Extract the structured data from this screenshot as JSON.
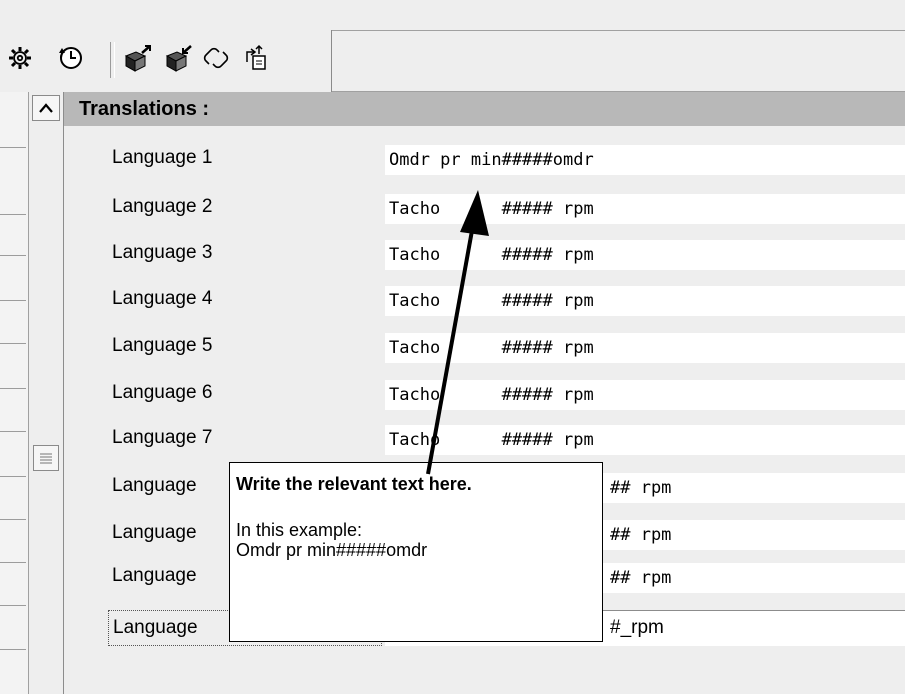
{
  "toolbar": {
    "icons": [
      "gear-settings-icon",
      "clock-icon",
      "package-export-icon",
      "package-import-icon",
      "link-icon",
      "upload-icon"
    ]
  },
  "panel": {
    "title": "Translations :"
  },
  "rows": [
    {
      "label": "Language 1",
      "value": "Omdr pr min#####omdr"
    },
    {
      "label": "Language 2",
      "value": "Tacho      ##### rpm"
    },
    {
      "label": "Language 3",
      "value": "Tacho      ##### rpm"
    },
    {
      "label": "Language 4",
      "value": "Tacho      ##### rpm"
    },
    {
      "label": "Language 5",
      "value": "Tacho      ##### rpm"
    },
    {
      "label": "Language 6",
      "value": "Tacho      ##### rpm"
    },
    {
      "label": "Language 7",
      "value": "Tacho      ##### rpm"
    },
    {
      "label": "Language",
      "value": "## rpm"
    },
    {
      "label": "Language",
      "value": "## rpm"
    },
    {
      "label": "Language",
      "value": "## rpm"
    },
    {
      "label": "Language",
      "value": "#_rpm"
    }
  ],
  "callout": {
    "title": "Write the relevant text here.",
    "line1": "In this example:",
    "line2": "Omdr pr min#####omdr"
  }
}
